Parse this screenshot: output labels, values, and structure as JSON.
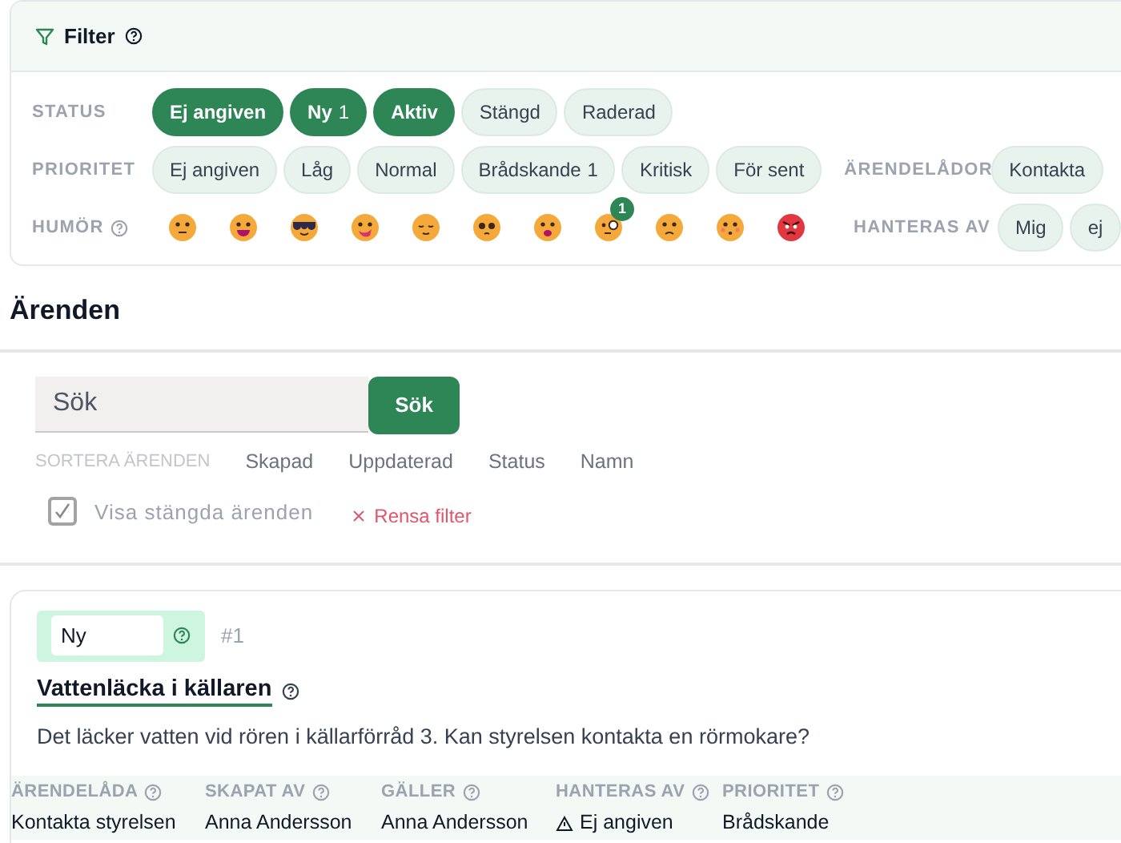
{
  "filter": {
    "title": "Filter",
    "status": {
      "label": "STATUS",
      "chips": [
        {
          "label": "Ej angiven",
          "selected": true
        },
        {
          "label": "Ny",
          "count": "1",
          "selected": true
        },
        {
          "label": "Aktiv",
          "selected": true
        },
        {
          "label": "Stängd",
          "selected": false
        },
        {
          "label": "Raderad",
          "selected": false
        }
      ]
    },
    "priority": {
      "label": "PRIORITET",
      "chips": [
        {
          "label": "Ej angiven",
          "selected": false
        },
        {
          "label": "Låg",
          "selected": false
        },
        {
          "label": "Normal",
          "selected": false
        },
        {
          "label": "Brådskande",
          "count": "1",
          "selected": false
        },
        {
          "label": "Kritisk",
          "selected": false
        },
        {
          "label": "För sent",
          "selected": false
        }
      ]
    },
    "inboxes": {
      "label": "ÄRENDELÅDOR",
      "chips": [
        {
          "label": "Kontakta",
          "selected": false
        }
      ]
    },
    "mood": {
      "label": "HUMÖR",
      "moods": [
        {
          "kind": "neutral"
        },
        {
          "kind": "grin"
        },
        {
          "kind": "cool"
        },
        {
          "kind": "silly"
        },
        {
          "kind": "relieved"
        },
        {
          "kind": "pleading"
        },
        {
          "kind": "shocked"
        },
        {
          "kind": "monocle",
          "count": "1"
        },
        {
          "kind": "worried"
        },
        {
          "kind": "flushed"
        },
        {
          "kind": "angry"
        }
      ]
    },
    "handler": {
      "label": "HANTERAS AV",
      "chips": [
        {
          "label": "Mig",
          "selected": false
        },
        {
          "label": "ej",
          "selected": false
        }
      ]
    }
  },
  "heading": "Ärenden",
  "search": {
    "placeholder": "Sök",
    "button": "Sök"
  },
  "sort": {
    "label": "SORTERA ÄRENDEN",
    "options": [
      "Skapad",
      "Uppdaterad",
      "Status",
      "Namn"
    ]
  },
  "show_closed": {
    "label": "Visa stängda ärenden",
    "checked": true
  },
  "clear": "Rensa filter",
  "ticket": {
    "status": "Ny",
    "number": "#1",
    "title": "Vattenläcka i källaren",
    "description": "Det läcker vatten vid rören i källarförråd 3. Kan styrelsen kontakta en rörmokare?",
    "fields": [
      {
        "label": "ÄRENDELÅDA",
        "value": "Kontakta styrelsen",
        "warning": false
      },
      {
        "label": "SKAPAT AV",
        "value": "Anna Andersson",
        "warning": false
      },
      {
        "label": "GÄLLER",
        "value": "Anna Andersson",
        "warning": false
      },
      {
        "label": "HANTERAS AV",
        "value": "Ej angiven",
        "warning": true
      },
      {
        "label": "PRIORITET",
        "value": "Brådskande",
        "warning": false
      }
    ]
  }
}
